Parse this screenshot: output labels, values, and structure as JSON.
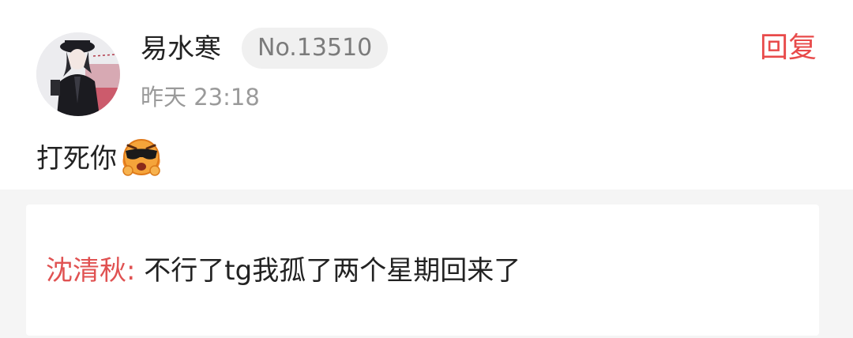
{
  "comment": {
    "username": "易水寒",
    "level_badge": "No.13510",
    "time": "昨天 23:18",
    "reply_label": "回复",
    "content_text": "打死你",
    "emoji_icon": "angry-sunglasses-emoji-icon",
    "avatar_icon": "user-avatar-illustration"
  },
  "quote": {
    "author": "沈清秋:",
    "text": "不行了tg我孤了两个星期回来了"
  },
  "colors": {
    "accent_red": "#e84a4a",
    "quote_author": "#e05252",
    "badge_bg": "#f0f0f0",
    "page_bg": "#f5f5f5"
  }
}
